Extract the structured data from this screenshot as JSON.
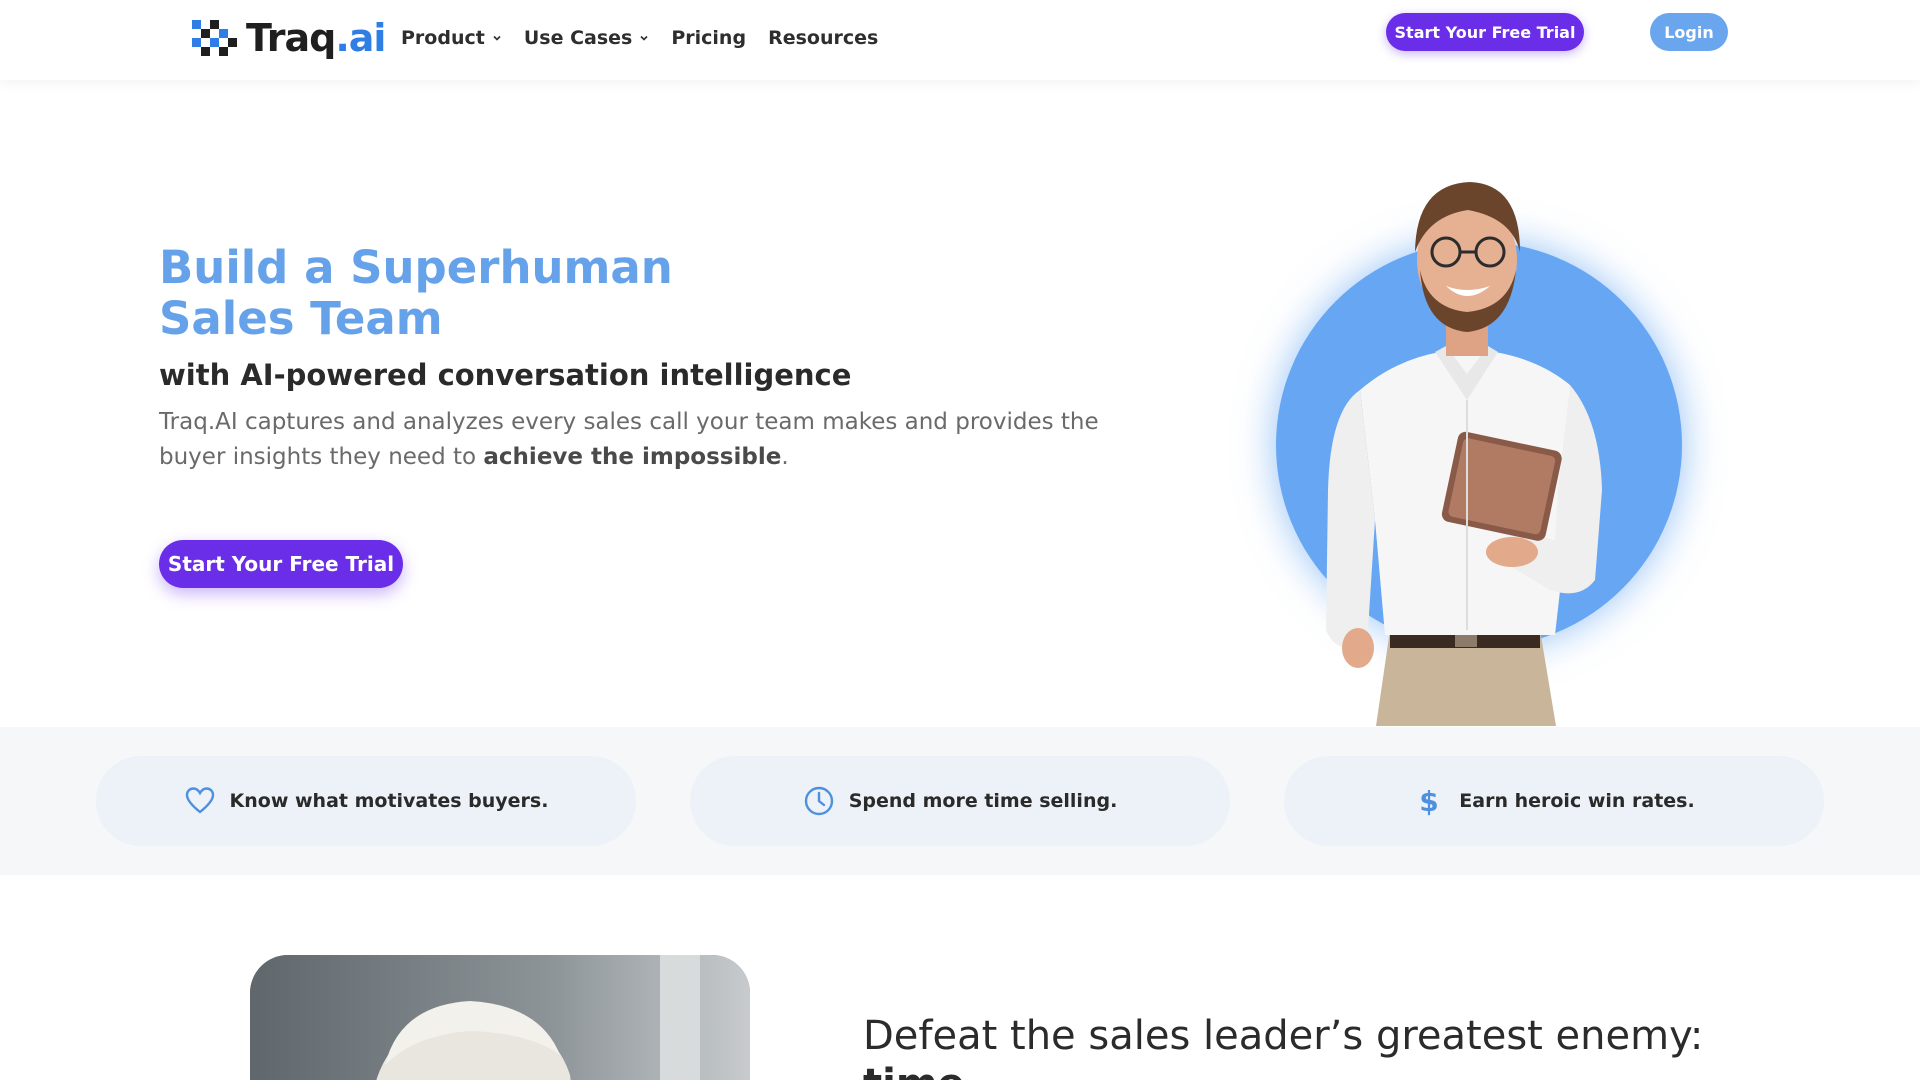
{
  "header": {
    "logo": {
      "text_main": "Traq",
      "text_accent": ".ai"
    },
    "nav": [
      {
        "label": "Product",
        "has_dropdown": true
      },
      {
        "label": "Use Cases",
        "has_dropdown": true
      },
      {
        "label": "Pricing",
        "has_dropdown": false
      },
      {
        "label": "Resources",
        "has_dropdown": false
      }
    ],
    "cta_label": "Start Your Free Trial",
    "login_label": "Login"
  },
  "hero": {
    "title_line1": "Build a Superhuman",
    "title_line2": "Sales Team",
    "subtitle": "with AI-powered conversation intelligence",
    "description_prefix": "Traq.AI captures and analyzes every sales call your team makes and provides the buyer insights they need to ",
    "description_bold": "achieve the impossible",
    "description_suffix": ".",
    "cta_label": "Start Your Free Trial"
  },
  "features": [
    {
      "icon": "heart-icon",
      "text": "Know what motivates buyers."
    },
    {
      "icon": "clock-icon",
      "text": "Spend more time selling."
    },
    {
      "icon": "dollar-icon",
      "text": "Earn heroic win rates."
    }
  ],
  "section2": {
    "title": "Defeat the sales leader’s greatest enemy:",
    "title_bold": "time"
  },
  "colors": {
    "brand_purple": "#6b2ee8",
    "brand_blue": "#66a2ea",
    "login_blue": "#6aa6ee",
    "feature_bg": "#edf2f8",
    "icon_blue": "#4d90e0"
  }
}
